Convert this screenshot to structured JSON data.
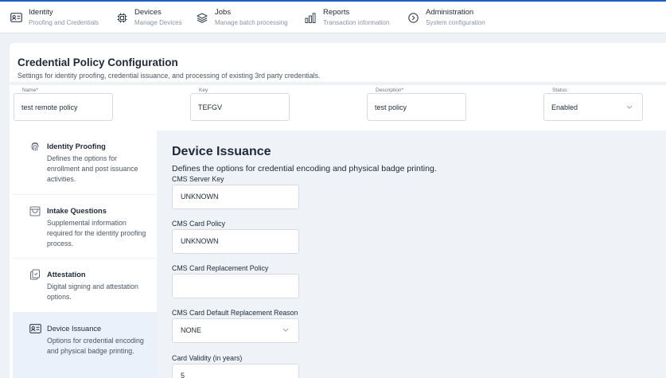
{
  "nav": {
    "items": [
      {
        "title": "Identity",
        "subtitle": "Proofing and Credentials",
        "icon": "id-card-icon"
      },
      {
        "title": "Devices",
        "subtitle": "Manage Devices",
        "icon": "chip-icon"
      },
      {
        "title": "Jobs",
        "subtitle": "Manage batch processing",
        "icon": "layers-icon"
      },
      {
        "title": "Reports",
        "subtitle": "Transaction information",
        "icon": "bar-chart-icon"
      },
      {
        "title": "Administration",
        "subtitle": "System configuration",
        "icon": "settings-circle-icon"
      }
    ]
  },
  "page": {
    "title": "Credential Policy Configuration",
    "subtitle": "Settings for identity proofing, credential issuance, and processing of existing 3rd party credentials."
  },
  "policy_fields": {
    "name": {
      "label": "Name*",
      "value": "test remote policy"
    },
    "key": {
      "label": "Key",
      "value": "TEFGV"
    },
    "description": {
      "label": "Description*",
      "value": "test policy"
    },
    "status": {
      "label": "Status:",
      "value": "Enabled"
    }
  },
  "sidebar": {
    "items": [
      {
        "title": "Identity Proofing",
        "desc": "Defines the options for enrollment and post issuance activities.",
        "icon": "fingerprint-icon"
      },
      {
        "title": "Intake Questions",
        "desc": "Supplemental information required for the identity proofing process.",
        "icon": "inbox-icon"
      },
      {
        "title": "Attestation",
        "desc": "Digital signing and attestation options.",
        "icon": "documents-icon"
      },
      {
        "title": "Device Issuance",
        "desc": "Options for credential encoding and physical badge printing.",
        "icon": "badge-icon"
      }
    ]
  },
  "main": {
    "title": "Device Issuance",
    "description": "Defines the options for credential encoding and physical badge printing.",
    "fields": {
      "cms_server_key": {
        "label": "CMS Server Key",
        "value": "UNKNOWN"
      },
      "cms_card_policy": {
        "label": "CMS Card Policy",
        "value": "UNKNOWN"
      },
      "cms_card_replacement_policy": {
        "label": "CMS Card Replacement Policy",
        "value": ""
      },
      "cms_card_default_replacement_reason": {
        "label": "CMS Card Default Replacement Reason",
        "value": "NONE"
      },
      "card_validity": {
        "label": "Card Validity (in years)",
        "value": "5"
      }
    }
  },
  "colors": {
    "accent": "#1f5fbf",
    "active_bg": "#eaf1fb",
    "panel_bg": "#eff2f6"
  }
}
